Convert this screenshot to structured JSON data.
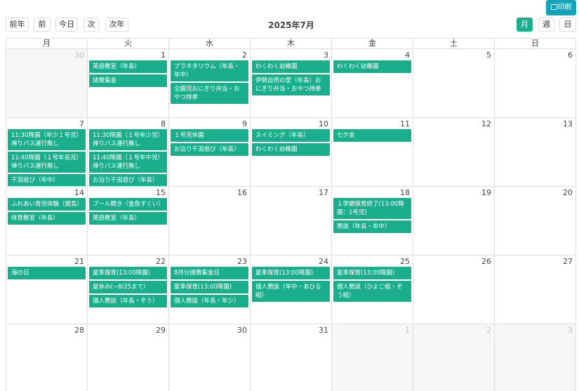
{
  "print_button": {
    "label": "印刷"
  },
  "nav": {
    "prev_year": "前年",
    "prev": "前",
    "today": "今日",
    "next": "次",
    "next_year": "次年"
  },
  "title": "2025年7月",
  "views": {
    "month": "月",
    "week": "週",
    "day": "日"
  },
  "weekdays": [
    "月",
    "火",
    "水",
    "木",
    "金",
    "土",
    "日"
  ],
  "weeks": [
    [
      {
        "day": "30",
        "other": true,
        "events": []
      },
      {
        "day": "1",
        "events": [
          "英語教室（年長）",
          "諸費集金"
        ]
      },
      {
        "day": "2",
        "events": [
          "プラネタリウム（年長・年中）",
          "全園児おにぎり弁当・おやつ持参"
        ]
      },
      {
        "day": "3",
        "events": [
          "わくわく幼稚園",
          "伊勢自然の里（年長）おにぎり弁当・おやつ持参"
        ]
      },
      {
        "day": "4",
        "events": [
          "わくわく幼稚園"
        ]
      },
      {
        "day": "5",
        "events": []
      },
      {
        "day": "6",
        "events": []
      }
    ],
    [
      {
        "day": "7",
        "events": [
          "11:30降園（年少１号児）帰りバス運行無し",
          "11:40降園（１号年長児）帰りバス運行無し",
          "干潟遊び（年中）"
        ]
      },
      {
        "day": "8",
        "events": [
          "11:30降園（１号年少児）帰りバス運行無し",
          "11:40降園（１号年中児）帰りバス運行無し",
          "お泊り干潟遊び（年長）"
        ]
      },
      {
        "day": "9",
        "events": [
          "１号児休園",
          "お泊り干潟遊び（年長）"
        ]
      },
      {
        "day": "10",
        "events": [
          "スイミング（年長）",
          "わくわく幼稚園"
        ]
      },
      {
        "day": "11",
        "events": [
          "七夕会"
        ]
      },
      {
        "day": "12",
        "events": []
      },
      {
        "day": "13",
        "events": []
      }
    ],
    [
      {
        "day": "14",
        "events": [
          "ふれあい育児体験（姫島）",
          "体育教室（年長）"
        ]
      },
      {
        "day": "15",
        "events": [
          "プール開き（金魚すくい）",
          "英語教室（年長）"
        ]
      },
      {
        "day": "16",
        "events": []
      },
      {
        "day": "17",
        "events": []
      },
      {
        "day": "18",
        "events": [
          "１学期保育終了(13:00降園：1号児)",
          "懇談（年長・年中）"
        ]
      },
      {
        "day": "19",
        "events": []
      },
      {
        "day": "20",
        "events": []
      }
    ],
    [
      {
        "day": "21",
        "events": [
          "海の日"
        ]
      },
      {
        "day": "22",
        "events": [
          "夏季保育(13:00降園)",
          "夏休み(~8/25まで）",
          "個人懇談（年長・ぞう）"
        ]
      },
      {
        "day": "23",
        "events": [
          "8月分諸費集金日",
          "夏季保育(13:00降園)",
          "個人懇談（年長・年少）"
        ]
      },
      {
        "day": "24",
        "events": [
          "夏季保育(13:00降園)",
          "個人懇談（年中・あひる組）"
        ]
      },
      {
        "day": "25",
        "events": [
          "夏季保育(13:00降園)",
          "個人懇談（ひよこ組・ぞう組）"
        ]
      },
      {
        "day": "26",
        "events": []
      },
      {
        "day": "27",
        "events": []
      }
    ],
    [
      {
        "day": "28",
        "events": []
      },
      {
        "day": "29",
        "events": []
      },
      {
        "day": "30",
        "events": []
      },
      {
        "day": "31",
        "events": []
      },
      {
        "day": "1",
        "other": true,
        "events": []
      },
      {
        "day": "2",
        "other": true,
        "events": []
      },
      {
        "day": "3",
        "other": true,
        "events": []
      }
    ]
  ]
}
